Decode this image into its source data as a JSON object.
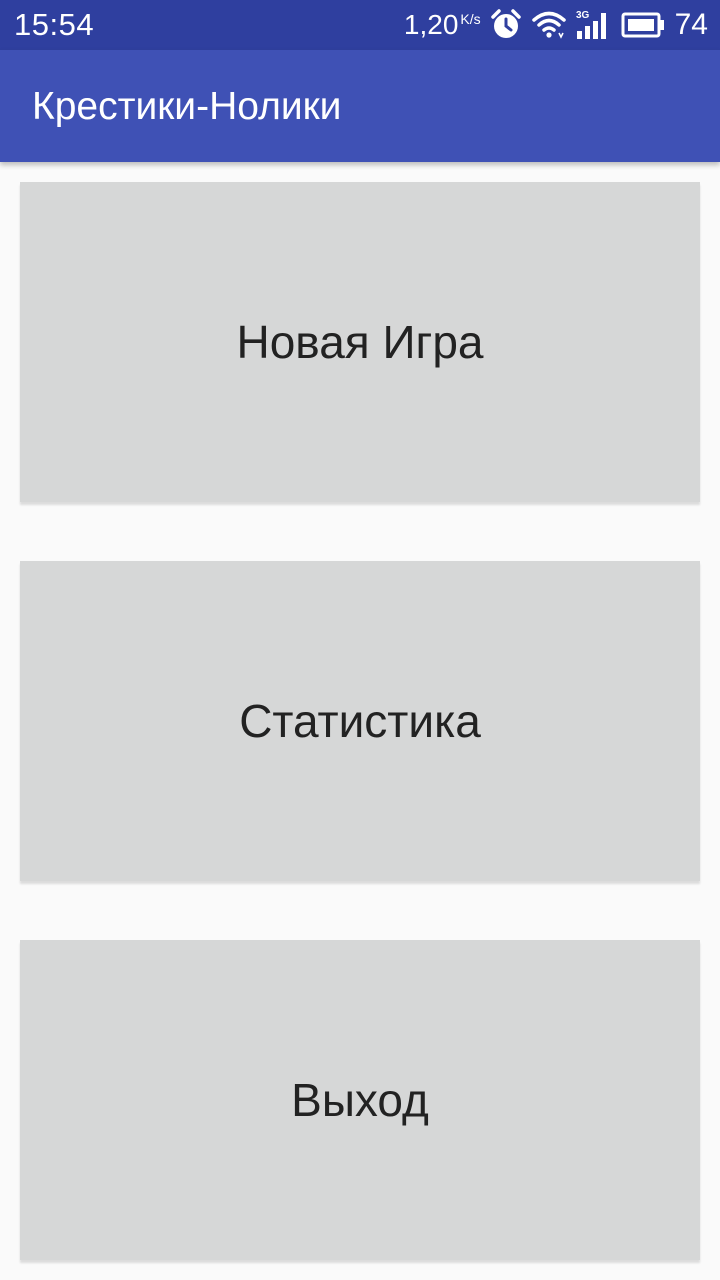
{
  "status_bar": {
    "time": "15:54",
    "net_speed": "1,20",
    "net_unit": "K/s",
    "network_type": "3G",
    "battery_level": "74",
    "icons": [
      "alarm-icon",
      "wifi-icon",
      "cell-signal-icon",
      "battery-icon"
    ]
  },
  "app_bar": {
    "title": "Крестики-Нолики",
    "color": "#3f51b5",
    "status_color": "#2f3f9f"
  },
  "menu": {
    "new_game_label": "Новая Игра",
    "statistics_label": "Статистика",
    "exit_label": "Выход",
    "button_color": "#d6d7d7"
  }
}
